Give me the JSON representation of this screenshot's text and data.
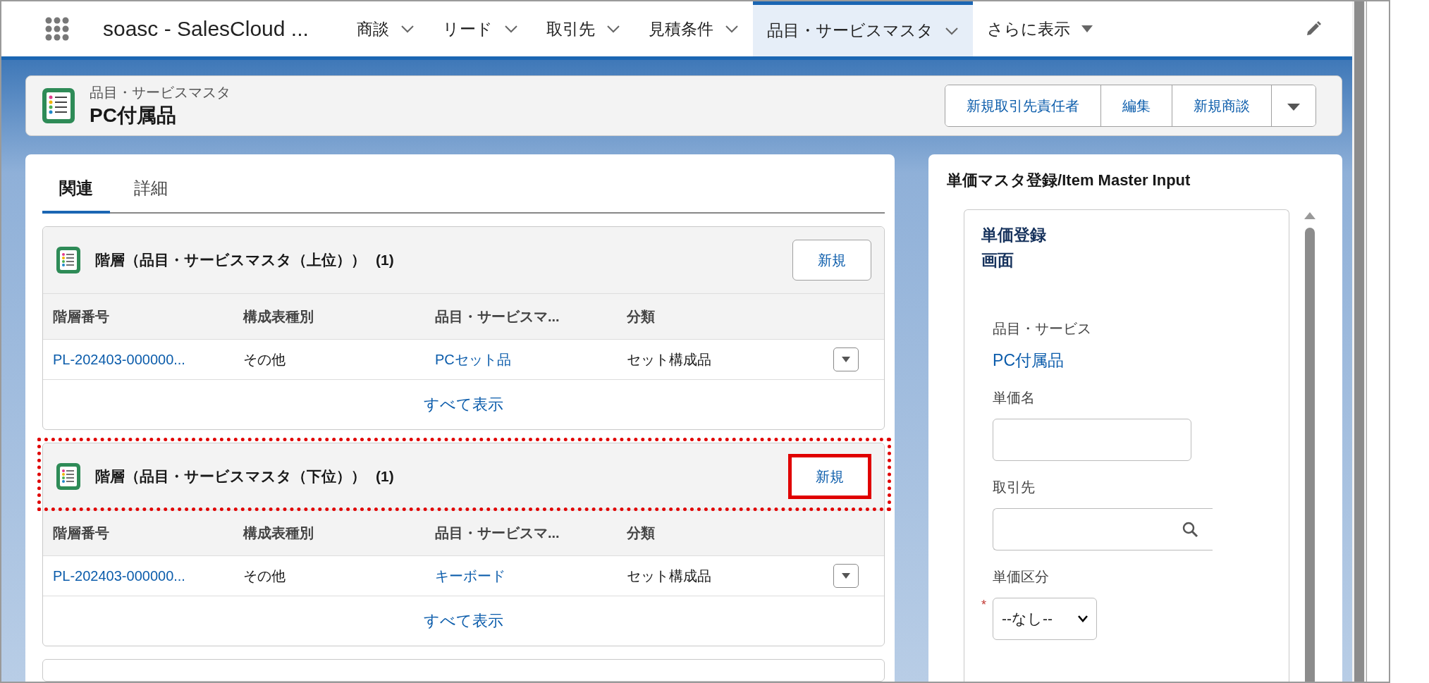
{
  "app_name": "soasc - SalesCloud ...",
  "nav_tabs": [
    {
      "label": "商談",
      "selected": false
    },
    {
      "label": "リード",
      "selected": false
    },
    {
      "label": "取引先",
      "selected": false
    },
    {
      "label": "見積条件",
      "selected": false
    },
    {
      "label": "品目・サービスマスタ",
      "selected": true
    }
  ],
  "more_menu": "さらに表示",
  "record": {
    "object_type": "品目・サービスマスタ",
    "name": "PC付属品"
  },
  "actions": [
    "新規取引先責任者",
    "編集",
    "新規商談"
  ],
  "record_tabs": [
    {
      "label": "関連",
      "selected": true
    },
    {
      "label": "詳細",
      "selected": false
    }
  ],
  "related_lists": [
    {
      "title": "階層（品目・サービスマスタ（上位））",
      "count": "(1)",
      "new_button": "新規",
      "highlighted": false,
      "columns": [
        {
          "label": "階層番号",
          "kind": "link"
        },
        {
          "label": "構成表種別",
          "kind": "text"
        },
        {
          "label": "品目・サービスマ...",
          "kind": "link"
        },
        {
          "label": "分類",
          "kind": "text"
        }
      ],
      "rows": [
        [
          "PL-202403-000000...",
          "その他",
          "PCセット品",
          "セット構成品"
        ]
      ],
      "view_all": "すべて表示"
    },
    {
      "title": "階層（品目・サービスマスタ（下位））",
      "count": "(1)",
      "new_button": "新規",
      "highlighted": true,
      "columns": [
        {
          "label": "階層番号",
          "kind": "link"
        },
        {
          "label": "構成表種別",
          "kind": "text"
        },
        {
          "label": "品目・サービスマ...",
          "kind": "link"
        },
        {
          "label": "分類",
          "kind": "text"
        }
      ],
      "rows": [
        [
          "PL-202403-000000...",
          "その他",
          "キーボード",
          "セット構成品"
        ]
      ],
      "view_all": "すべて表示"
    }
  ],
  "side_panel": {
    "title": "単価マスタ登録/Item Master Input",
    "card_title": "単価登録画面",
    "fields": [
      {
        "kind": "readonly",
        "label": "品目・サービス",
        "value": "PC付属品"
      },
      {
        "kind": "text",
        "label": "単価名"
      },
      {
        "kind": "lookup",
        "label": "取引先"
      },
      {
        "kind": "select",
        "label": "単価区分",
        "value": "--なし--",
        "required_mark": "*"
      }
    ]
  }
}
